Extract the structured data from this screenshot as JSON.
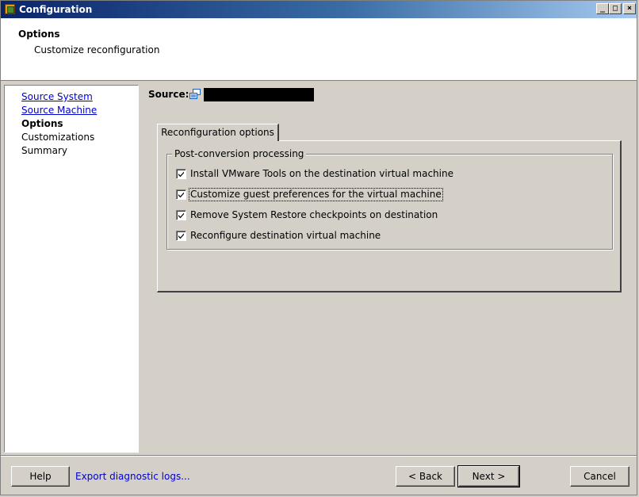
{
  "window": {
    "title": "Configuration",
    "controls": {
      "minimize": "_",
      "maximize": "□",
      "close": "×"
    }
  },
  "header": {
    "title": "Options",
    "subtitle": "Customize reconfiguration"
  },
  "nav": {
    "items": [
      {
        "label": "Source System",
        "state": "link"
      },
      {
        "label": "Source Machine",
        "state": "link"
      },
      {
        "label": "Options",
        "state": "current"
      },
      {
        "label": "Customizations",
        "state": "plain"
      },
      {
        "label": "Summary",
        "state": "plain"
      }
    ]
  },
  "source": {
    "label": "Source:",
    "icon": "computer-icon",
    "value": ""
  },
  "tabs": [
    {
      "label": "Reconfiguration options",
      "active": true
    }
  ],
  "group": {
    "legend": "Post-conversion processing",
    "options": [
      {
        "label": "Install VMware Tools on the destination virtual machine",
        "checked": true,
        "focused": false
      },
      {
        "label": "Customize guest preferences for the virtual machine",
        "checked": true,
        "focused": true
      },
      {
        "label": "Remove System Restore checkpoints on destination",
        "checked": true,
        "focused": false
      },
      {
        "label": "Reconfigure destination virtual machine",
        "checked": true,
        "focused": false
      }
    ]
  },
  "footer": {
    "help_label": "Help",
    "export_link": "Export diagnostic logs...",
    "back_label": "< Back",
    "next_label": "Next >",
    "cancel_label": "Cancel"
  },
  "colors": {
    "titlebar_start": "#0a246a",
    "titlebar_end": "#a6caf0",
    "link": "#0000cc",
    "face": "#d4d0c8"
  }
}
